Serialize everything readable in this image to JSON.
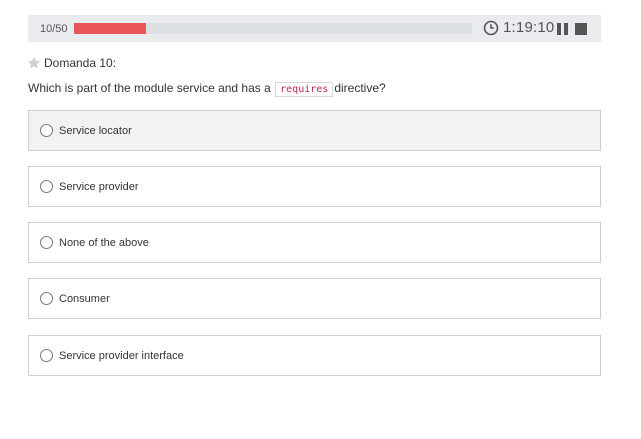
{
  "header": {
    "progress_text": "10/50",
    "progress_fraction": 0.18,
    "timer": "1:19:10",
    "icons": [
      "clock-icon",
      "pause-icon",
      "stop-icon"
    ]
  },
  "question": {
    "title": "Domanda 10:",
    "text_before": "Which is part of the module service and has a",
    "code": "requires",
    "text_after": "directive?",
    "star_icon": "star-icon"
  },
  "options": [
    {
      "label": "Service locator",
      "highlighted": true
    },
    {
      "label": "Service provider",
      "highlighted": false
    },
    {
      "label": "None of the above",
      "highlighted": false
    },
    {
      "label": "Consumer",
      "highlighted": false
    },
    {
      "label": "Service provider interface",
      "highlighted": false
    }
  ],
  "colors": {
    "progress_fill": "#e8565a",
    "topbar_bg": "#e9ebee",
    "option_highlight_bg": "#f1f2f4"
  }
}
